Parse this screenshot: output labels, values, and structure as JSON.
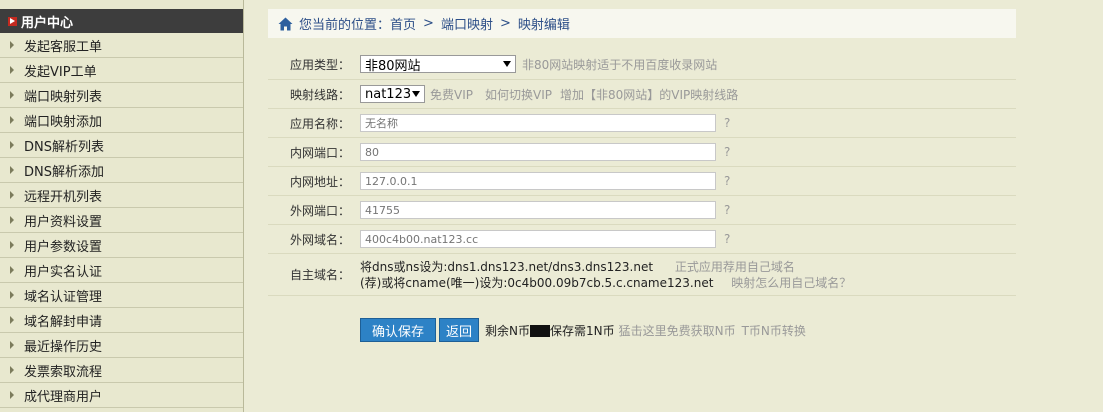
{
  "sidebar": {
    "title": "用户中心",
    "items": [
      {
        "label": "发起客服工单"
      },
      {
        "label": "发起VIP工单"
      },
      {
        "label": "端口映射列表"
      },
      {
        "label": "端口映射添加"
      },
      {
        "label": "DNS解析列表"
      },
      {
        "label": "DNS解析添加"
      },
      {
        "label": "远程开机列表"
      },
      {
        "label": "用户资料设置"
      },
      {
        "label": "用户参数设置"
      },
      {
        "label": "用户实名认证"
      },
      {
        "label": "域名认证管理"
      },
      {
        "label": "域名解封申请"
      },
      {
        "label": "最近操作历史"
      },
      {
        "label": "发票索取流程"
      },
      {
        "label": "成代理商用户"
      }
    ]
  },
  "breadcrumb": {
    "prefix": "您当前的位置：",
    "items": [
      "首页",
      "端口映射",
      "映射编辑"
    ],
    "separator": ">"
  },
  "form": {
    "app_type": {
      "label": "应用类型：",
      "value": "非80网站",
      "hint": "非80网站映射适于不用百度收录网站"
    },
    "line": {
      "label": "映射线路：",
      "value": "nat123",
      "free_vip": "免费VIP",
      "how_switch": "如何切换VIP",
      "add_vip": "增加【非80网站】的VIP映射线路"
    },
    "app_name": {
      "label": "应用名称：",
      "placeholder": "无名称",
      "q": "?"
    },
    "lan_port": {
      "label": "内网端口：",
      "placeholder": "80",
      "q": "?"
    },
    "lan_addr": {
      "label": "内网地址：",
      "placeholder": "127.0.0.1",
      "q": "?"
    },
    "wan_port": {
      "label": "外网端口：",
      "placeholder": "41755",
      "q": "?"
    },
    "wan_domain": {
      "label": "外网域名：",
      "placeholder": "400c4b00.nat123.cc",
      "q": "?"
    },
    "own_domain": {
      "label": "自主域名：",
      "line1": "将dns或ns设为:dns1.dns123.net/dns3.dns123.net",
      "line1_hint": "正式应用荐用自己域名",
      "line2": "(荐)或将cname(唯一)设为:0c4b00.09b7cb.5.c.cname123.net",
      "line2_hint": "映射怎么用自己域名？"
    },
    "buttons": {
      "confirm": "确认保存",
      "back": "返回"
    },
    "balance": {
      "prefix": "剩余N币",
      "suffix": "保存需1N币",
      "free_link": "猛击这里免费获取N币",
      "convert_link": "T币N币转换"
    }
  }
}
